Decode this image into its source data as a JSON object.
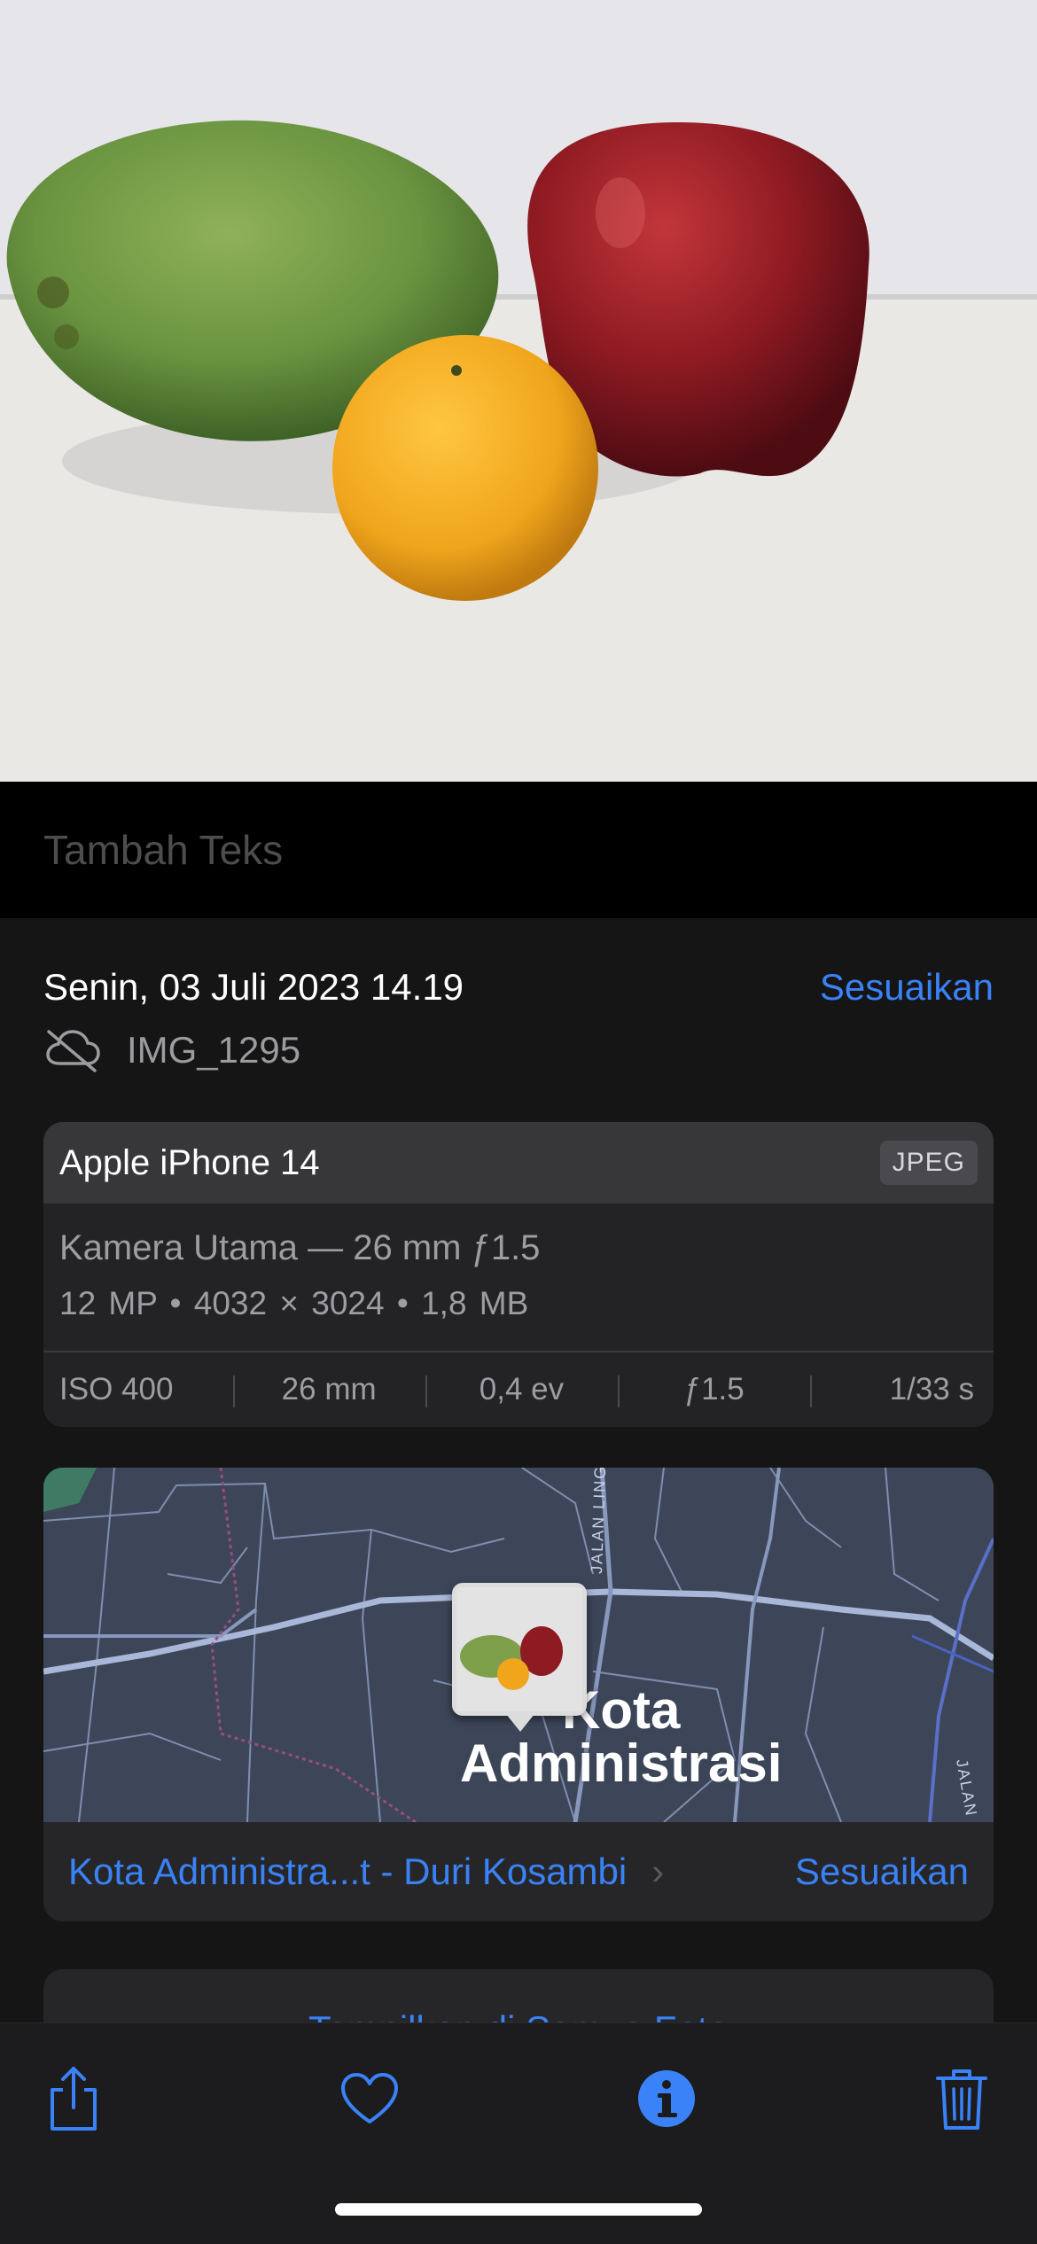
{
  "caption": {
    "placeholder": "Tambah Teks"
  },
  "info": {
    "date": "Senin, 03 Juli 2023 14.19",
    "adjust_label": "Sesuaikan",
    "file_name": "IMG_1295",
    "cloud_status_icon": "cloud-slash-icon"
  },
  "camera": {
    "device": "Apple iPhone 14",
    "format": "JPEG",
    "lens": "Kamera Utama — 26 mm ƒ1.5",
    "specs": "12 MP • 4032 × 3024 • 1,8 MB",
    "exif": {
      "iso": "ISO 400",
      "focal": "26 mm",
      "ev": "0,4 ev",
      "aperture": "ƒ1.5",
      "shutter": "1/33 s"
    }
  },
  "map": {
    "label_line1": "Kota",
    "label_line2": "Administrasi",
    "street_1": "JALAN LINGKAR",
    "street_2": "JALAN",
    "location": "Kota Administra...t - Duri Kosambi",
    "chevron": "›",
    "adjust_label": "Sesuaikan"
  },
  "show_all": {
    "label": "Tampilkan di Semua Foto"
  },
  "toolbar": {
    "share_icon": "share-icon",
    "favorite_icon": "heart-icon",
    "info_icon": "info-icon",
    "delete_icon": "trash-icon"
  },
  "colors": {
    "accent": "#3a82f7",
    "sheet_bg": "#151516",
    "card_bg": "#232325",
    "map_bg": "#3d4659"
  }
}
